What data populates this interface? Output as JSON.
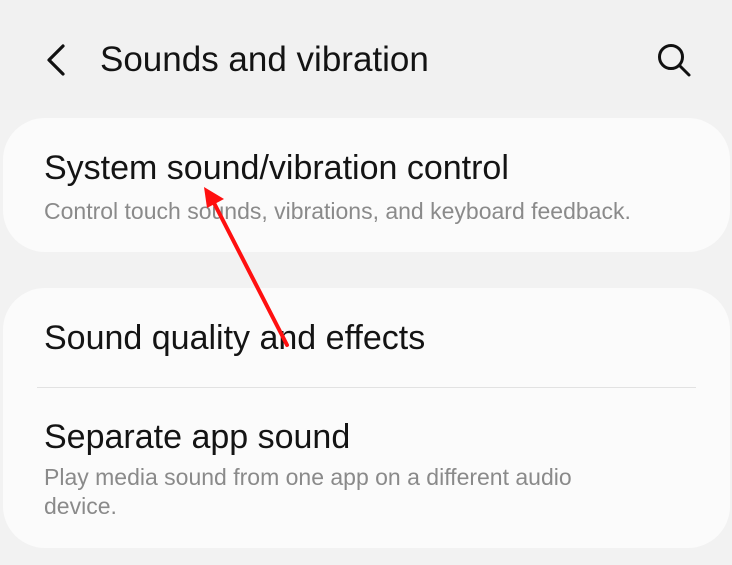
{
  "header": {
    "title": "Sounds and vibration",
    "back_icon": "chevron-left-icon",
    "search_icon": "search-icon"
  },
  "items": {
    "system": {
      "title": "System sound/vibration control",
      "subtitle": "Control touch sounds, vibrations, and keyboard feedback."
    },
    "quality": {
      "title": "Sound quality and effects"
    },
    "separate": {
      "title": "Separate app sound",
      "subtitle_line1": "Play media sound from one app on a different audio",
      "subtitle_line2": "device."
    }
  },
  "colors": {
    "background": "#f2f2f2",
    "card": "#fbfbfb",
    "primary_text": "#141414",
    "secondary_text": "#8a8a8a",
    "annotation_arrow": "#ff1010"
  }
}
